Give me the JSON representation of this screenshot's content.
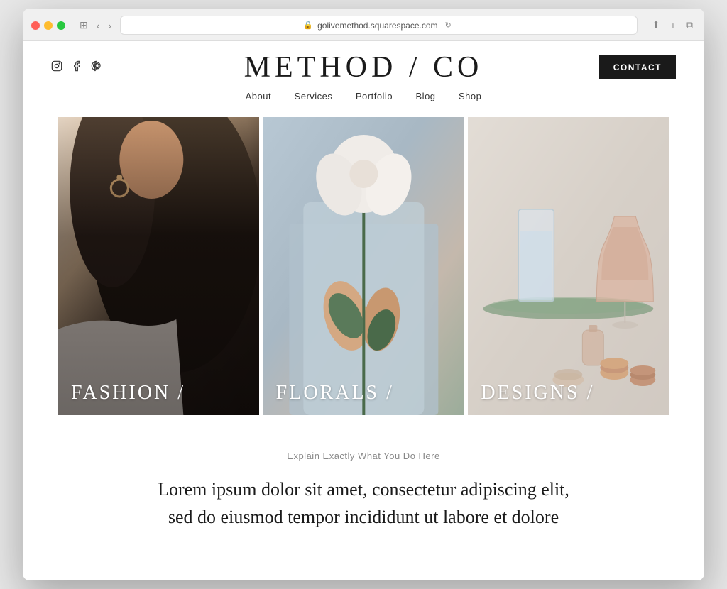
{
  "browser": {
    "url": "golivemethod.squarespace.com",
    "back_label": "‹",
    "forward_label": "›",
    "reload_label": "↻",
    "share_label": "⬆",
    "add_tab_label": "+",
    "duplicate_label": "⧉"
  },
  "site": {
    "title": "METHOD / CO",
    "nav": {
      "items": [
        {
          "label": "About",
          "href": "#"
        },
        {
          "label": "Services",
          "href": "#"
        },
        {
          "label": "Portfolio",
          "href": "#"
        },
        {
          "label": "Blog",
          "href": "#"
        },
        {
          "label": "Shop",
          "href": "#"
        }
      ]
    },
    "contact_button": "CONTACT",
    "social": {
      "instagram_label": "instagram-icon",
      "facebook_label": "facebook-icon",
      "pinterest_label": "pinterest-icon"
    },
    "grid": {
      "items": [
        {
          "label": "FASHION /",
          "type": "fashion"
        },
        {
          "label": "FLORALS /",
          "type": "florals"
        },
        {
          "label": "DESIGNS /",
          "type": "designs"
        }
      ]
    },
    "lower": {
      "subtitle": "Explain Exactly What You Do Here",
      "body_text": "Lorem ipsum dolor sit amet, consectetur adipiscing elit, sed do eiusmod tempor incididunt ut labore et dolore"
    }
  }
}
